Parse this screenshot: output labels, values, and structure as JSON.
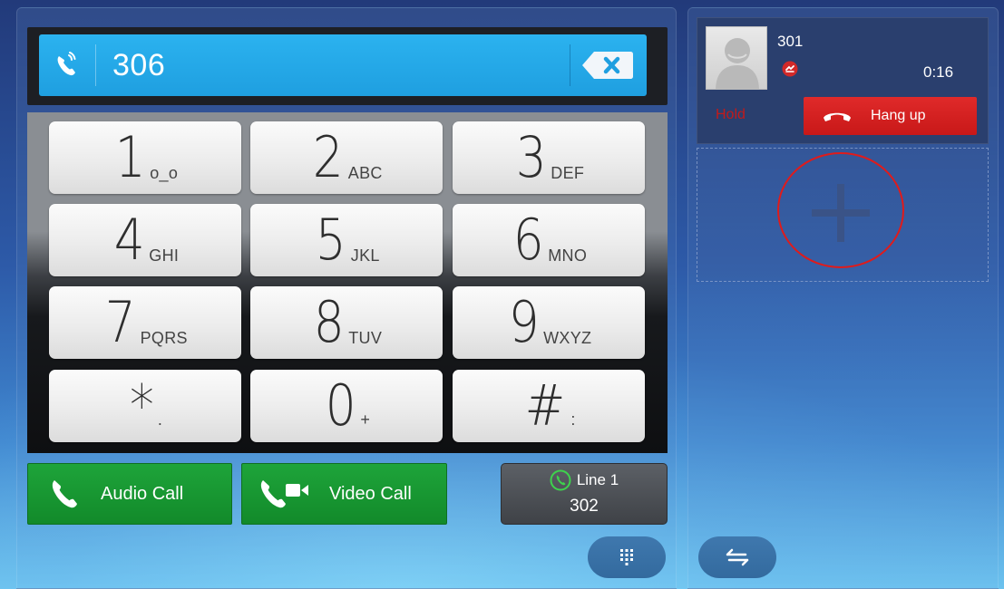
{
  "dialer": {
    "value": "306",
    "keys": [
      {
        "digit": "1",
        "letters": "o_o"
      },
      {
        "digit": "2",
        "letters": "ABC"
      },
      {
        "digit": "3",
        "letters": "DEF"
      },
      {
        "digit": "4",
        "letters": "GHI"
      },
      {
        "digit": "5",
        "letters": "JKL"
      },
      {
        "digit": "6",
        "letters": "MNO"
      },
      {
        "digit": "7",
        "letters": "PQRS"
      },
      {
        "digit": "8",
        "letters": "TUV"
      },
      {
        "digit": "9",
        "letters": "WXYZ"
      },
      {
        "digit": "*",
        "letters": "."
      },
      {
        "digit": "0",
        "letters": "+"
      },
      {
        "digit": "#",
        "letters": ":"
      }
    ],
    "audio_call_label": "Audio Call",
    "video_call_label": "Video Call",
    "line": {
      "label": "Line 1",
      "number": "302"
    }
  },
  "active_call": {
    "number": "301",
    "duration": "0:16",
    "hold_label": "Hold",
    "hangup_label": "Hang up"
  },
  "icons": {
    "dial_mode": "handset-signal-icon",
    "backspace": "backspace-icon",
    "audio": "phone-icon",
    "video": "video-phone-icon",
    "line_status": "green-phone-circle-icon",
    "keypad": "keypad-icon",
    "swap": "swap-arrows-icon",
    "add": "plus-icon",
    "hangup": "hangup-icon"
  },
  "colors": {
    "input_blue": "#1f9fe0",
    "call_green": "#1ea43a",
    "hangup_red": "#d42020",
    "annotation_red": "#e01b1b"
  }
}
